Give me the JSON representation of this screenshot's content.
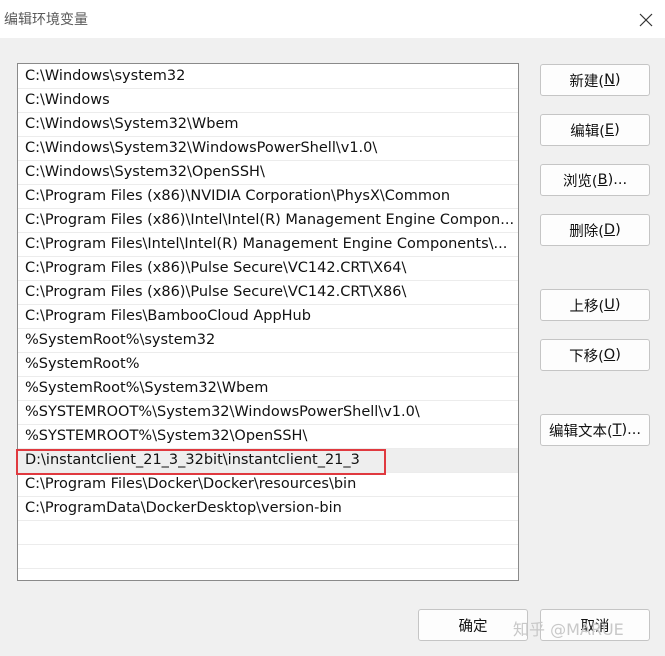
{
  "window": {
    "title": "编辑环境变量",
    "close_icon": "close-icon"
  },
  "paths": [
    "C:\\Windows\\system32",
    "C:\\Windows",
    "C:\\Windows\\System32\\Wbem",
    "C:\\Windows\\System32\\WindowsPowerShell\\v1.0\\",
    "C:\\Windows\\System32\\OpenSSH\\",
    "C:\\Program Files (x86)\\NVIDIA Corporation\\PhysX\\Common",
    "C:\\Program Files (x86)\\Intel\\Intel(R) Management Engine Compon...",
    "C:\\Program Files\\Intel\\Intel(R) Management Engine Components\\...",
    "C:\\Program Files (x86)\\Pulse Secure\\VC142.CRT\\X64\\",
    "C:\\Program Files (x86)\\Pulse Secure\\VC142.CRT\\X86\\",
    "C:\\Program Files\\BambooCloud AppHub",
    "%SystemRoot%\\system32",
    "%SystemRoot%",
    "%SystemRoot%\\System32\\Wbem",
    "%SYSTEMROOT%\\System32\\WindowsPowerShell\\v1.0\\",
    "%SYSTEMROOT%\\System32\\OpenSSH\\",
    "D:\\instantclient_21_3_32bit\\instantclient_21_3",
    "C:\\Program Files\\Docker\\Docker\\resources\\bin",
    "C:\\ProgramData\\DockerDesktop\\version-bin"
  ],
  "selected_index": 16,
  "highlight_color": "#e0393f",
  "buttons": {
    "new": {
      "label": "新建(",
      "key": "N",
      "end": ")"
    },
    "edit": {
      "label": "编辑(",
      "key": "E",
      "end": ")"
    },
    "browse": {
      "label": "浏览(",
      "key": "B",
      "end": ")..."
    },
    "delete": {
      "label": "删除(",
      "key": "D",
      "end": ")"
    },
    "move_up": {
      "label": "上移(",
      "key": "U",
      "end": ")"
    },
    "move_down": {
      "label": "下移(",
      "key": "O",
      "end": ")"
    },
    "edit_text": {
      "label": "编辑文本(",
      "key": "T",
      "end": ")..."
    },
    "ok": "确定",
    "cancel": "取消"
  },
  "watermark": "知乎 @MARUE"
}
